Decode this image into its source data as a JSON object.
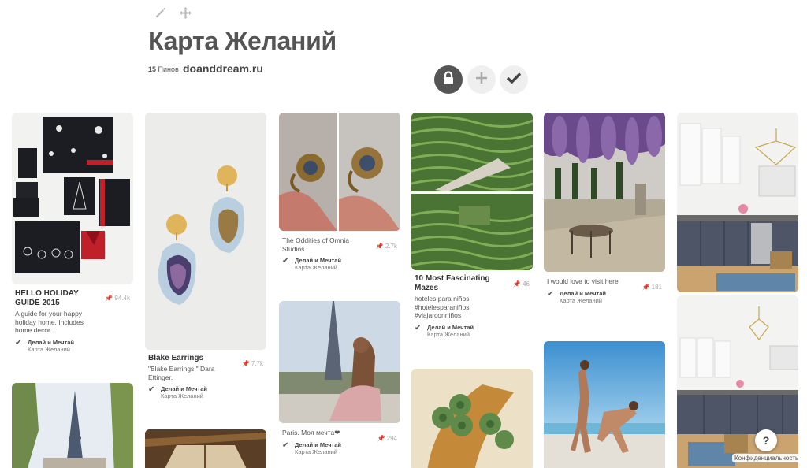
{
  "header": {
    "title": "Карта Желаний",
    "pin_count_number": "15",
    "pin_count_word": "Пинов",
    "site": "doanddream.ru",
    "icons": [
      "pencil-icon",
      "move-icon",
      "lock-icon",
      "plus-icon",
      "check-icon"
    ]
  },
  "board_credit": {
    "user": "Делай и Мечтай",
    "board": "Карта Желаний"
  },
  "pins": [
    {
      "id": "holiday",
      "title": "HELLO HOLIDAY GUIDE 2015",
      "desc": "A guide for your happy holiday home. Includes home decor...",
      "repins": "94.4k"
    },
    {
      "id": "eiffel-1",
      "title": "",
      "desc": "",
      "repins": ""
    },
    {
      "id": "earrings",
      "title": "Blake Earrings",
      "desc": "\"Blake Earrings,\" Dara Ettinger.",
      "repins": "7.7k"
    },
    {
      "id": "interior",
      "title": "",
      "desc": "",
      "repins": ""
    },
    {
      "id": "rings",
      "title": "",
      "desc": "The Oddities of Omnia Studios",
      "repins": "2.7k"
    },
    {
      "id": "paris",
      "title": "",
      "desc": "Paris. Моя мечта❤",
      "repins": "294"
    },
    {
      "id": "mazes",
      "title": "10 Most Fascinating Mazes",
      "desc": "hoteles para niños #hotelesparaniños #viajarconniños",
      "repins": "46"
    },
    {
      "id": "clover",
      "title": "",
      "desc": "",
      "repins": ""
    },
    {
      "id": "garden",
      "title": "",
      "desc": "I would love to visit here",
      "repins": "181"
    },
    {
      "id": "beach",
      "title": "",
      "desc": "",
      "repins": ""
    },
    {
      "id": "kitchen-1",
      "title": "",
      "desc": "",
      "repins": ""
    },
    {
      "id": "kitchen-2",
      "title": "",
      "desc": "",
      "repins": ""
    }
  ],
  "footer": {
    "privacy": "Конфиденциальность",
    "help": "?"
  },
  "colors": {
    "title": "#555555",
    "lock_button": "#555555",
    "icon_gray": "#b5b5b5",
    "repin_gray": "#aaaaaa"
  }
}
